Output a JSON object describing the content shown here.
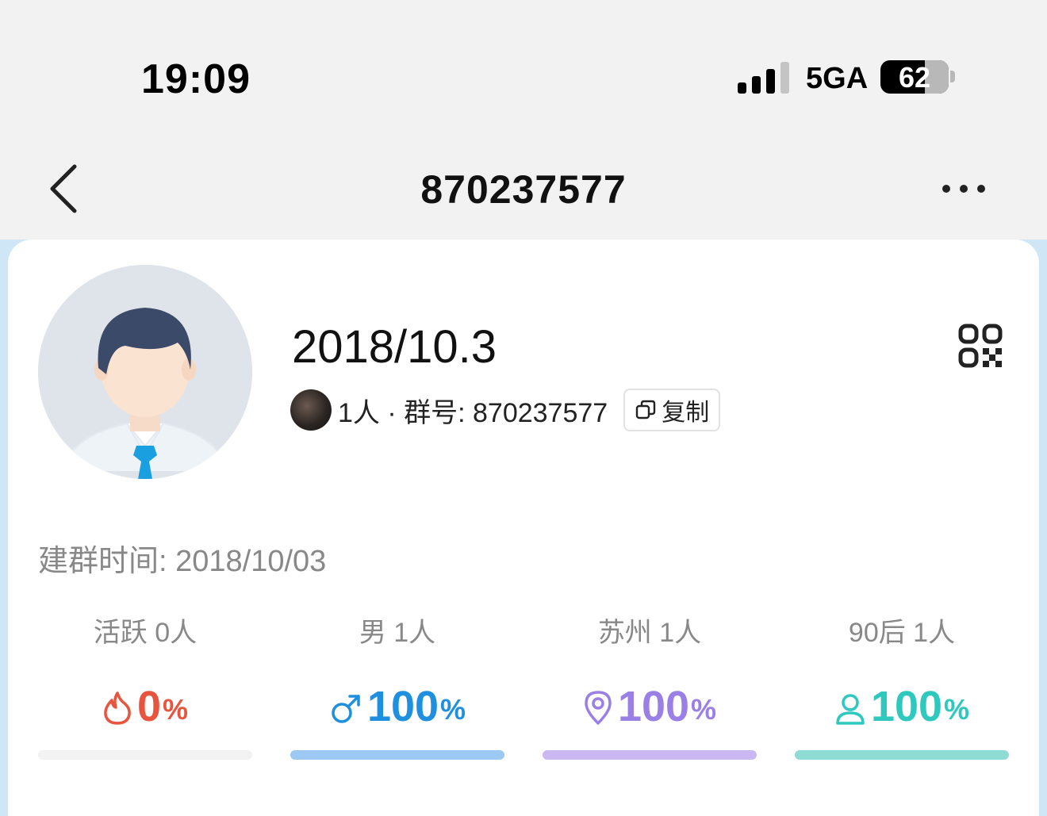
{
  "status_bar": {
    "time": "19:09",
    "network": "5GA",
    "battery": "62"
  },
  "nav": {
    "title": "870237577",
    "back_icon": "chevron-left-icon",
    "more_icon": "more-dots-icon"
  },
  "group": {
    "name": "2018/10.3",
    "member_text": "1人 · 群号: 870237577",
    "copy_label": "复制",
    "created": "建群时间: 2018/10/03"
  },
  "stats": [
    {
      "label": "活跃 0人",
      "value": "0",
      "unit": "%",
      "icon": "flame-icon",
      "color": "#e8553e",
      "bar_color": "#f2f2f2",
      "percent": 0
    },
    {
      "label": "男 1人",
      "value": "100",
      "unit": "%",
      "icon": "male-icon",
      "color": "#1f8fe0",
      "bar_color": "#9cc9f3",
      "percent": 100
    },
    {
      "label": "苏州 1人",
      "value": "100",
      "unit": "%",
      "icon": "location-pin-icon",
      "color": "#9a7fe6",
      "bar_color": "#c9b8f2",
      "percent": 100
    },
    {
      "label": "90后 1人",
      "value": "100",
      "unit": "%",
      "icon": "person-icon",
      "color": "#2fc8bf",
      "bar_color": "#8fdcd6",
      "percent": 100
    }
  ]
}
